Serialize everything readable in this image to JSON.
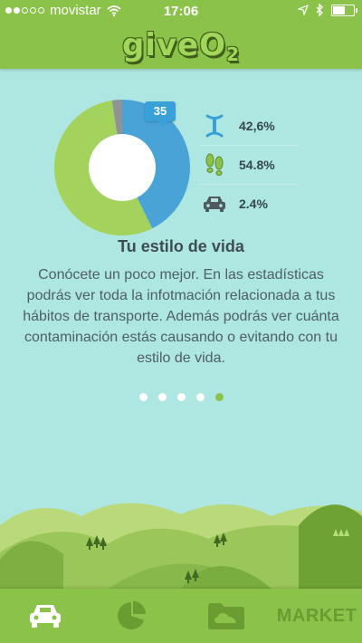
{
  "status_bar": {
    "carrier": "movistar",
    "time": "17:06",
    "signal_bars_filled": 2,
    "signal_bars_total": 5
  },
  "header": {
    "logo_text": "giveO",
    "logo_sub": "2"
  },
  "chart": {
    "badge": "35",
    "colors": {
      "blue": "#4aa3d6",
      "green": "#a3d35d",
      "gray": "#8f9393"
    }
  },
  "chart_data": {
    "type": "pie",
    "categories": [
      "bicicleta",
      "a pie",
      "coche"
    ],
    "values": [
      42.6,
      54.8,
      2.4
    ]
  },
  "legend": [
    {
      "icon": "bicycle-icon",
      "value": "42,6%"
    },
    {
      "icon": "footprints-icon",
      "value": "54.8%"
    },
    {
      "icon": "car-icon",
      "value": "2.4%"
    }
  ],
  "content": {
    "title": "Tu estilo de vida",
    "description": "Conócete un poco mejor. En las estadísticas podrás ver toda la infotmación relacionada a tus hábitos de transporte. Además podrás ver cuánta contaminación estás causando o evitando con tu estilo de vida."
  },
  "pager": {
    "total": 5,
    "active_index": 4
  },
  "tabs": {
    "market_label": "MARKET"
  }
}
